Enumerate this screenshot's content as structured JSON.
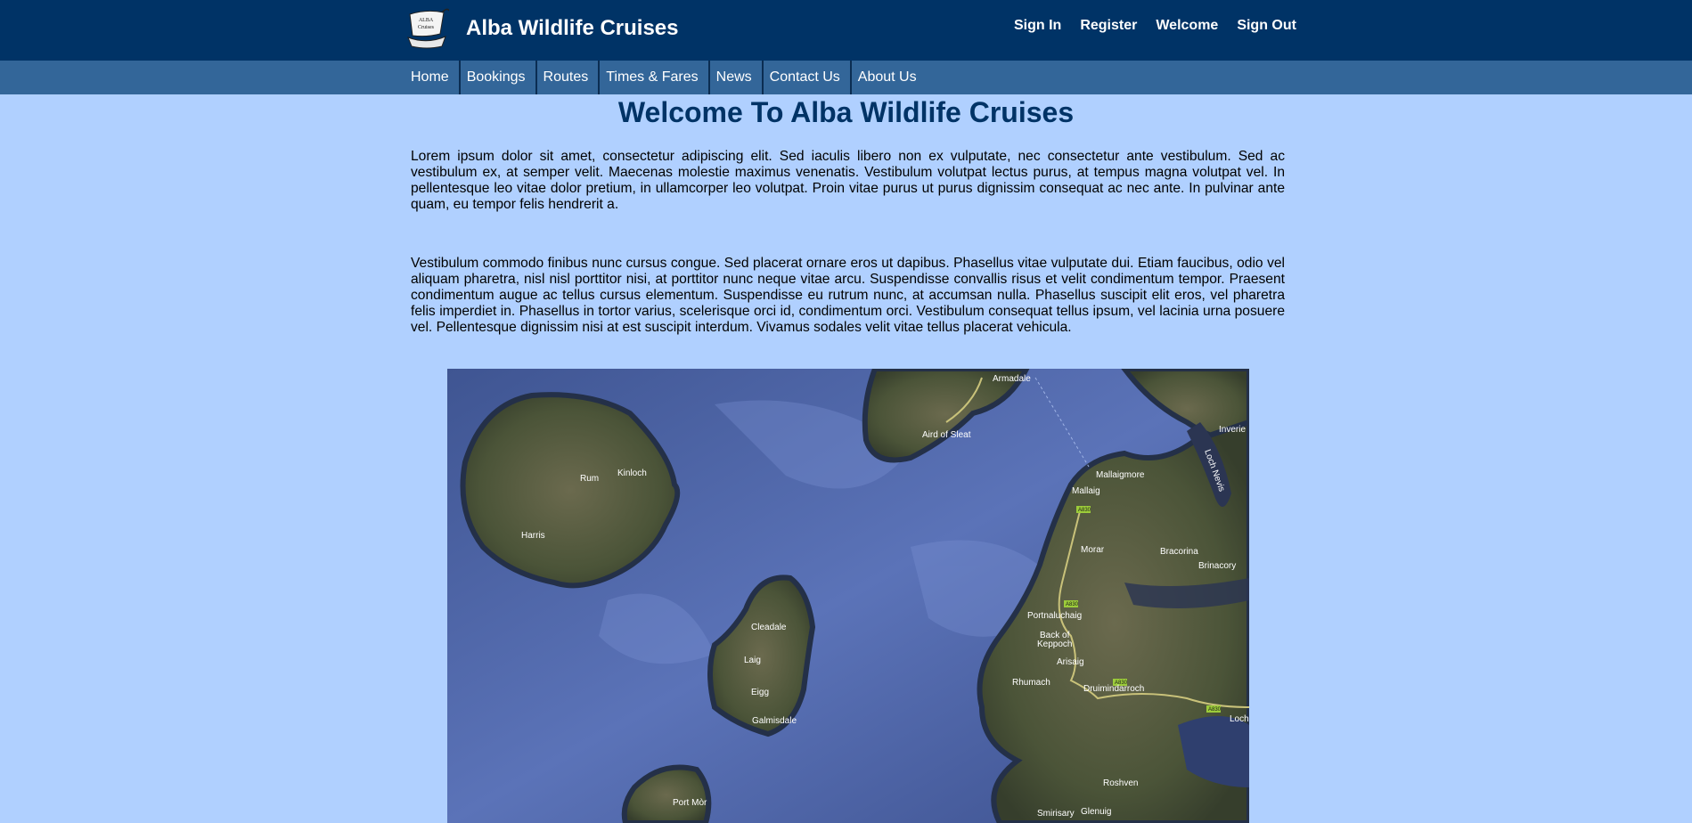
{
  "header": {
    "logo_text_line1": "ALBA",
    "logo_text_line2": "Cruises",
    "title": "Alba Wildlife Cruises",
    "account_links": [
      "Sign In",
      "Register",
      "Welcome",
      "Sign Out"
    ]
  },
  "nav": {
    "items": [
      "Home",
      "Bookings",
      "Routes",
      "Times & Fares",
      "News",
      "Contact Us",
      "About Us"
    ]
  },
  "main": {
    "heading": "Welcome To Alba Wildlife Cruises",
    "paragraph1": "Lorem ipsum dolor sit amet, consectetur adipiscing elit. Sed iaculis libero non ex vulputate, nec consectetur ante vestibulum. Sed ac vestibulum ex, at semper velit. Maecenas molestie maximus venenatis. Vestibulum volutpat lectus purus, at tempus magna volutpat vel. In pellentesque leo vitae dolor pretium, in ullamcorper leo volutpat. Proin vitae purus ut purus dignissim consequat ac nec ante. In pulvinar ante quam, eu tempor felis hendrerit a.",
    "paragraph2": "Vestibulum commodo finibus nunc cursus congue. Sed placerat ornare eros ut dapibus. Phasellus vitae vulputate dui. Etiam faucibus, odio vel aliquam pharetra, nisl nisl porttitor nisi, at porttitor nunc neque vitae arcu. Suspendisse convallis risus et velit condimentum tempor. Praesent condimentum augue ac tellus cursus elementum. Suspendisse eu rutrum nunc, at accumsan nulla. Phasellus suscipit elit eros, vel pharetra felis imperdiet in. Phasellus in tortor varius, scelerisque orci id, condimentum orci. Vestibulum consequat tellus ipsum, vel lacinia urna posuere vel. Pellentesque dignissim nisi at est suscipit interdum. Vivamus sodales velit vitae tellus placerat vehicula."
  },
  "map": {
    "places": {
      "armadale": "Armadale",
      "aird_of_sleat": "Aird of Sleat",
      "inverie": "Inverie",
      "loch_nevis": "Loch Nevis",
      "rum": "Rum",
      "kinloch": "Kinloch",
      "harris": "Harris",
      "mallaigmore": "Mallaigmore",
      "mallaig": "Mallaig",
      "morar": "Morar",
      "bracorina": "Bracorina",
      "brinacory": "Brinacory",
      "cleadale": "Cleadale",
      "laig": "Laig",
      "eigg": "Eigg",
      "galmisdale": "Galmisdale",
      "portnaluchaig": "Portnaluchaig",
      "back_of_keppoch_1": "Back of",
      "back_of_keppoch_2": "Keppoch",
      "arisaig": "Arisaig",
      "rhumach": "Rhumach",
      "druimindarroch": "Druimindarroch",
      "loch": "Loch",
      "roshven": "Roshven",
      "port_mor": "Port Mòr",
      "smirisary": "Smirisary",
      "glenuig": "Glenuig"
    },
    "road_badges": [
      "A830",
      "A830",
      "A830",
      "A830"
    ],
    "colors": {
      "sea": "#4a5f9e",
      "land": "#4a5a3a",
      "shore": "#2f3a52",
      "road": "#c9c27a"
    }
  }
}
